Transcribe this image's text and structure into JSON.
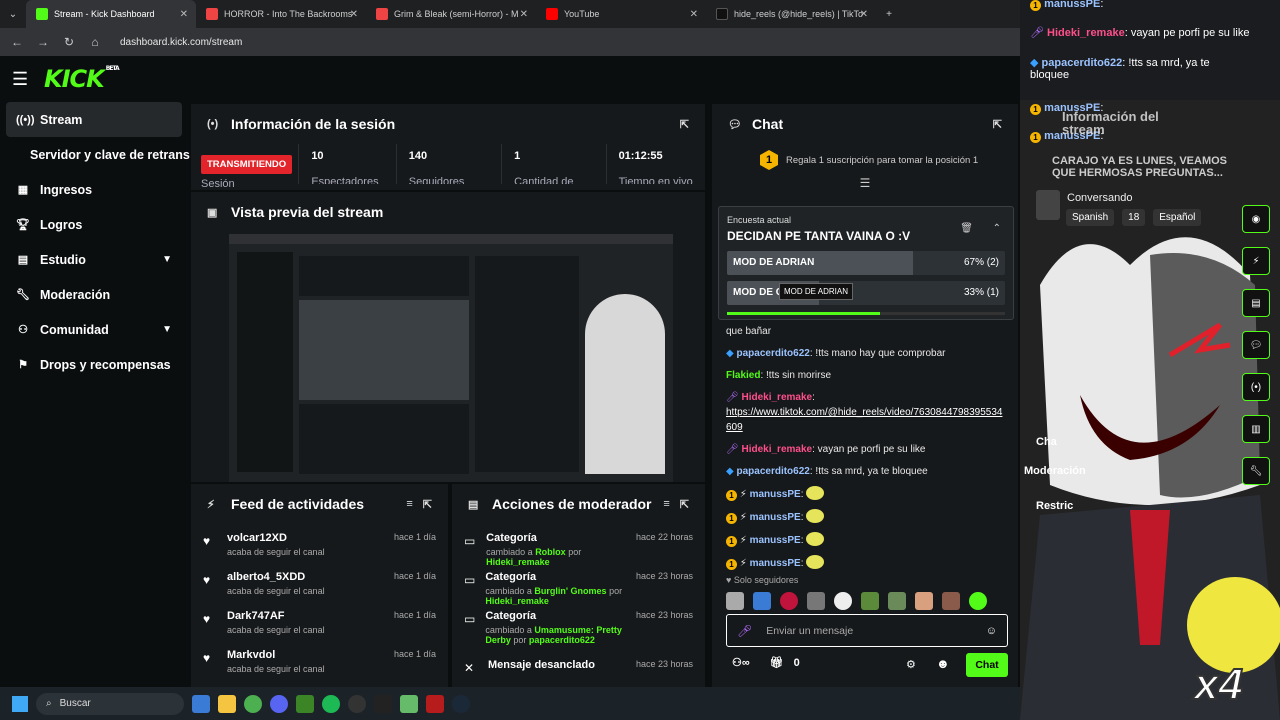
{
  "browser": {
    "tabs": [
      {
        "title": "Stream - Kick Dashboard",
        "color": "#53fc18"
      },
      {
        "title": "HORROR - Into The Backrooms",
        "color": "#e44"
      },
      {
        "title": "Grim & Bleak (semi-Horror) - M",
        "color": "#e44"
      },
      {
        "title": "YouTube",
        "color": "#ff0000"
      },
      {
        "title": "hide_reels (@hide_reels) | TikTo",
        "color": "#111"
      }
    ],
    "url": "dashboard.kick.com/stream"
  },
  "brand": {
    "logo": "KICK",
    "beta": "BETA",
    "accent": "#53fc18"
  },
  "sidebar": {
    "items": [
      {
        "label": "Stream",
        "icon": "broadcast-icon"
      },
      {
        "label": "Servidor y clave de retransmisión",
        "icon": ""
      },
      {
        "label": "Ingresos",
        "icon": "chart-icon"
      },
      {
        "label": "Logros",
        "icon": "trophy-icon"
      },
      {
        "label": "Estudio",
        "icon": "studio-icon"
      },
      {
        "label": "Moderación",
        "icon": "wrench-icon"
      },
      {
        "label": "Comunidad",
        "icon": "community-icon"
      },
      {
        "label": "Drops y recompensas",
        "icon": "drops-icon"
      }
    ]
  },
  "session": {
    "title": "Información de la sesión",
    "badge": "TRANSMITIENDO",
    "badge_sub": "Sesión",
    "stats": [
      {
        "value": "10",
        "label": "Espectadores"
      },
      {
        "value": "140",
        "label": "Seguidores"
      },
      {
        "value": "1",
        "label": "Cantidad de"
      },
      {
        "value": "01:12:55",
        "label": "Tiempo en vivo"
      }
    ]
  },
  "preview": {
    "title": "Vista previa del stream"
  },
  "feed": {
    "title": "Feed de actividades",
    "items": [
      {
        "name": "volcar12XD",
        "sub": "acaba de seguir el canal",
        "time": "hace 1 día"
      },
      {
        "name": "alberto4_5XDD",
        "sub": "acaba de seguir el canal",
        "time": "hace 1 día"
      },
      {
        "name": "Dark747AF",
        "sub": "acaba de seguir el canal",
        "time": "hace 1 día"
      },
      {
        "name": "Markvdol",
        "sub": "acaba de seguir el canal",
        "time": "hace 1 día"
      }
    ]
  },
  "modactions": {
    "title": "Acciones de moderador",
    "items": [
      {
        "name": "Categoría",
        "prefix": "cambiado a",
        "what": "Roblox",
        "conj": "por",
        "who": "Hideki_remake",
        "time": "hace 22 horas"
      },
      {
        "name": "Categoría",
        "prefix": "cambiado a",
        "what": "Burglin' Gnomes",
        "conj": "por",
        "who": "Hideki_remake",
        "time": "hace 23 horas"
      },
      {
        "name": "Categoría",
        "prefix": "cambiado a",
        "what": "Umamusume: Pretty Derby",
        "conj": "por",
        "who": "papacerdito622",
        "time": "hace 23 horas"
      },
      {
        "name": "Mensaje desanclado",
        "prefix": "",
        "what": "",
        "conj": "",
        "who": "",
        "time": "hace 23 horas"
      }
    ]
  },
  "chat": {
    "title": "Chat",
    "gift_banner": "Regala 1 suscripción para tomar la posición 1",
    "poll": {
      "label": "Encuesta actual",
      "question": "DECIDAN PE TANTA VAINA O :V",
      "options": [
        {
          "text": "MOD DE ADRIAN",
          "result": "67% (2)",
          "fraction": 0.67
        },
        {
          "text": "MOD DE C",
          "result": "33% (1)",
          "fraction": 0.33
        }
      ],
      "tooltip": "MOD DE ADRIAN",
      "progress": 0.55
    },
    "messages": [
      {
        "user": "",
        "text": "que bañar",
        "cls": ""
      },
      {
        "user": "papacerdito622",
        "text": ": !tts mano hay que comprobar",
        "cls": "u-blue"
      },
      {
        "user": "Flakied",
        "text": ": !tts sin morirse",
        "cls": "u-green"
      },
      {
        "user": "Hideki_remake",
        "text": ":",
        "cls": "u-pink"
      },
      {
        "user": "",
        "text": "https://www.tiktok.com/@hide_reels/video/7630844798395534609",
        "cls": "link"
      },
      {
        "user": "Hideki_remake",
        "text": ": vayan pe porfi pe su like",
        "cls": "u-pink"
      },
      {
        "user": "papacerdito622",
        "text": ": !tts sa mrd, ya te bloquee",
        "cls": "u-blue"
      },
      {
        "user": "manussPE",
        "text": ":",
        "cls": "u-blue"
      },
      {
        "user": "manussPE",
        "text": ":",
        "cls": "u-blue"
      },
      {
        "user": "manussPE",
        "text": ":",
        "cls": "u-blue"
      },
      {
        "user": "manussPE",
        "text": ":",
        "cls": "u-blue"
      }
    ],
    "followers_only": "Solo seguidores",
    "input_placeholder": "Enviar un mensaje",
    "points": "0",
    "send": "Chat"
  },
  "overlay": {
    "lines": [
      {
        "user": "manussPE",
        "text": ":"
      },
      {
        "user": "Hideki_remake",
        "text": ": vayan pe porfi pe su like"
      },
      {
        "user": "papacerdito622",
        "text": ": !tts sa mrd, ya te bloquee"
      },
      {
        "user": "manussPE",
        "text": ":"
      },
      {
        "user": "manussPE",
        "text": ":"
      },
      {
        "user": "",
        "text": "CARAJO YA ES LUNES, VEAMOS QUE HERMOSAS PREGUNTAS..."
      }
    ],
    "ghost_title": "Información del stream",
    "status": "Conversando",
    "tags": [
      "Spanish",
      "18",
      "Español"
    ],
    "menu": [
      "Moderación",
      "Cha",
      "Restric"
    ],
    "multiplier": "x4"
  },
  "taskbar": {
    "search": "Buscar"
  }
}
